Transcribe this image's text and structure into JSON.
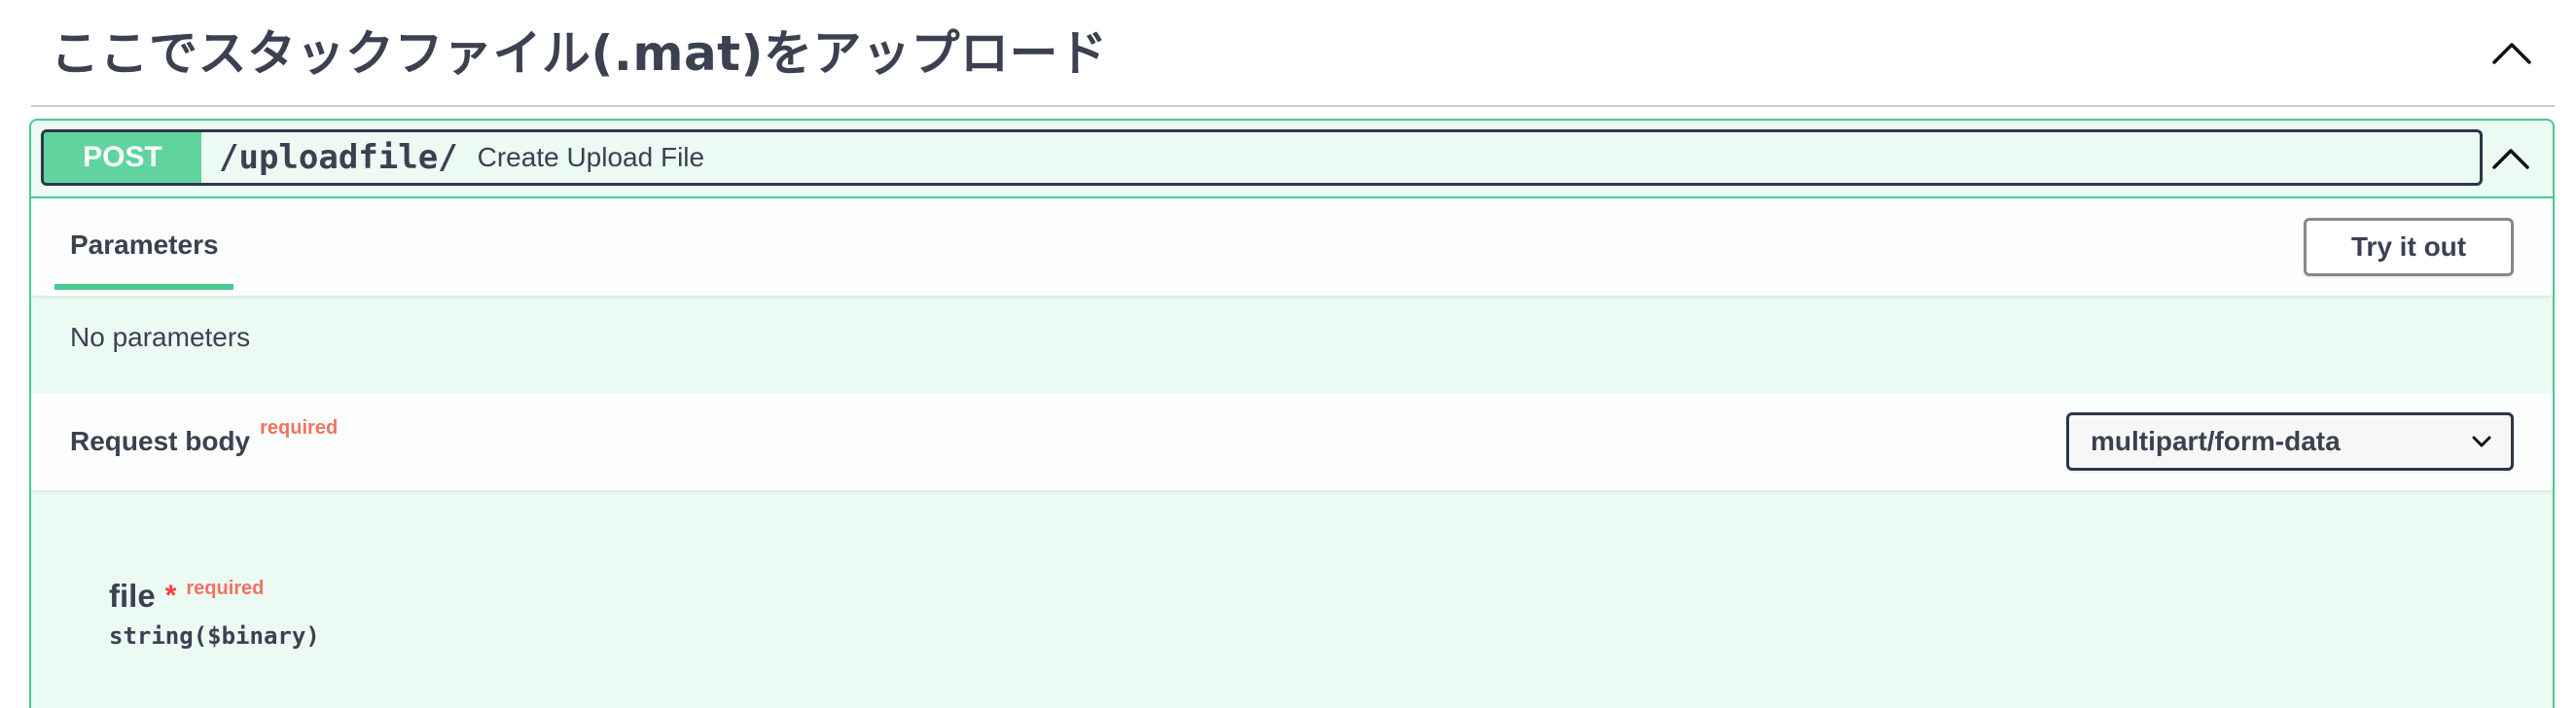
{
  "tag": {
    "title": "ここでスタックファイル(.mat)をアップロード",
    "toggle_icon": "chevron-up-icon"
  },
  "operation": {
    "method": "POST",
    "path": "/uploadfile/",
    "summary": "Create Upload File",
    "collapse_icon": "chevron-up-icon",
    "method_color": "#49cc90"
  },
  "parameters": {
    "tab_label": "Parameters",
    "try_button": "Try it out",
    "empty_text": "No parameters"
  },
  "request_body": {
    "title": "Request body",
    "required_label": "required",
    "content_type": "multipart/form-data",
    "dropdown_icon": "chevron-down-icon"
  },
  "fields": [
    {
      "name": "file",
      "required_marker": "*",
      "required_label": "required",
      "type": "string($binary)"
    }
  ]
}
